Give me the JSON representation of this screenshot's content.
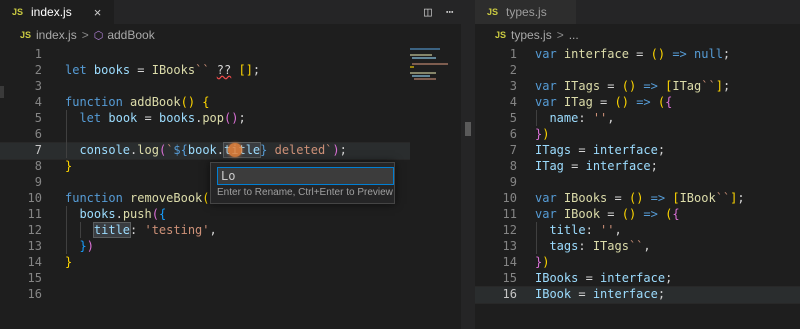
{
  "left_editor": {
    "tab": {
      "badge": "JS",
      "label": "index.js",
      "close": "×"
    },
    "actions": {
      "split": "◫",
      "more": "⋯"
    },
    "breadcrumb": {
      "badge": "JS",
      "file": "index.js",
      "separator": ">",
      "symbol": "addBook"
    },
    "line_numbers": [
      "1",
      "2",
      "3",
      "4",
      "5",
      "6",
      "7",
      "8",
      "9",
      "10",
      "11",
      "12",
      "13",
      "14",
      "15",
      "16"
    ],
    "current_line": "7",
    "rename": {
      "value": "Lo",
      "hint": "Enter to Rename, Ctrl+Enter to Preview"
    }
  },
  "right_editor": {
    "tab": {
      "badge": "JS",
      "label": "types.js"
    },
    "breadcrumb": {
      "badge": "JS",
      "file": "types.js",
      "separator": ">",
      "symbol": "..."
    },
    "line_numbers": [
      "1",
      "2",
      "3",
      "4",
      "5",
      "6",
      "7",
      "8",
      "9",
      "10",
      "11",
      "12",
      "13",
      "14",
      "15",
      "16"
    ],
    "current_line": "16"
  },
  "colors": {
    "background": "#1e1e1e",
    "tabbar": "#252526",
    "keyword": "#569cd6",
    "function": "#dcdcaa",
    "variable": "#9cdcfe",
    "string": "#ce9178",
    "accent": "#007fd4"
  }
}
